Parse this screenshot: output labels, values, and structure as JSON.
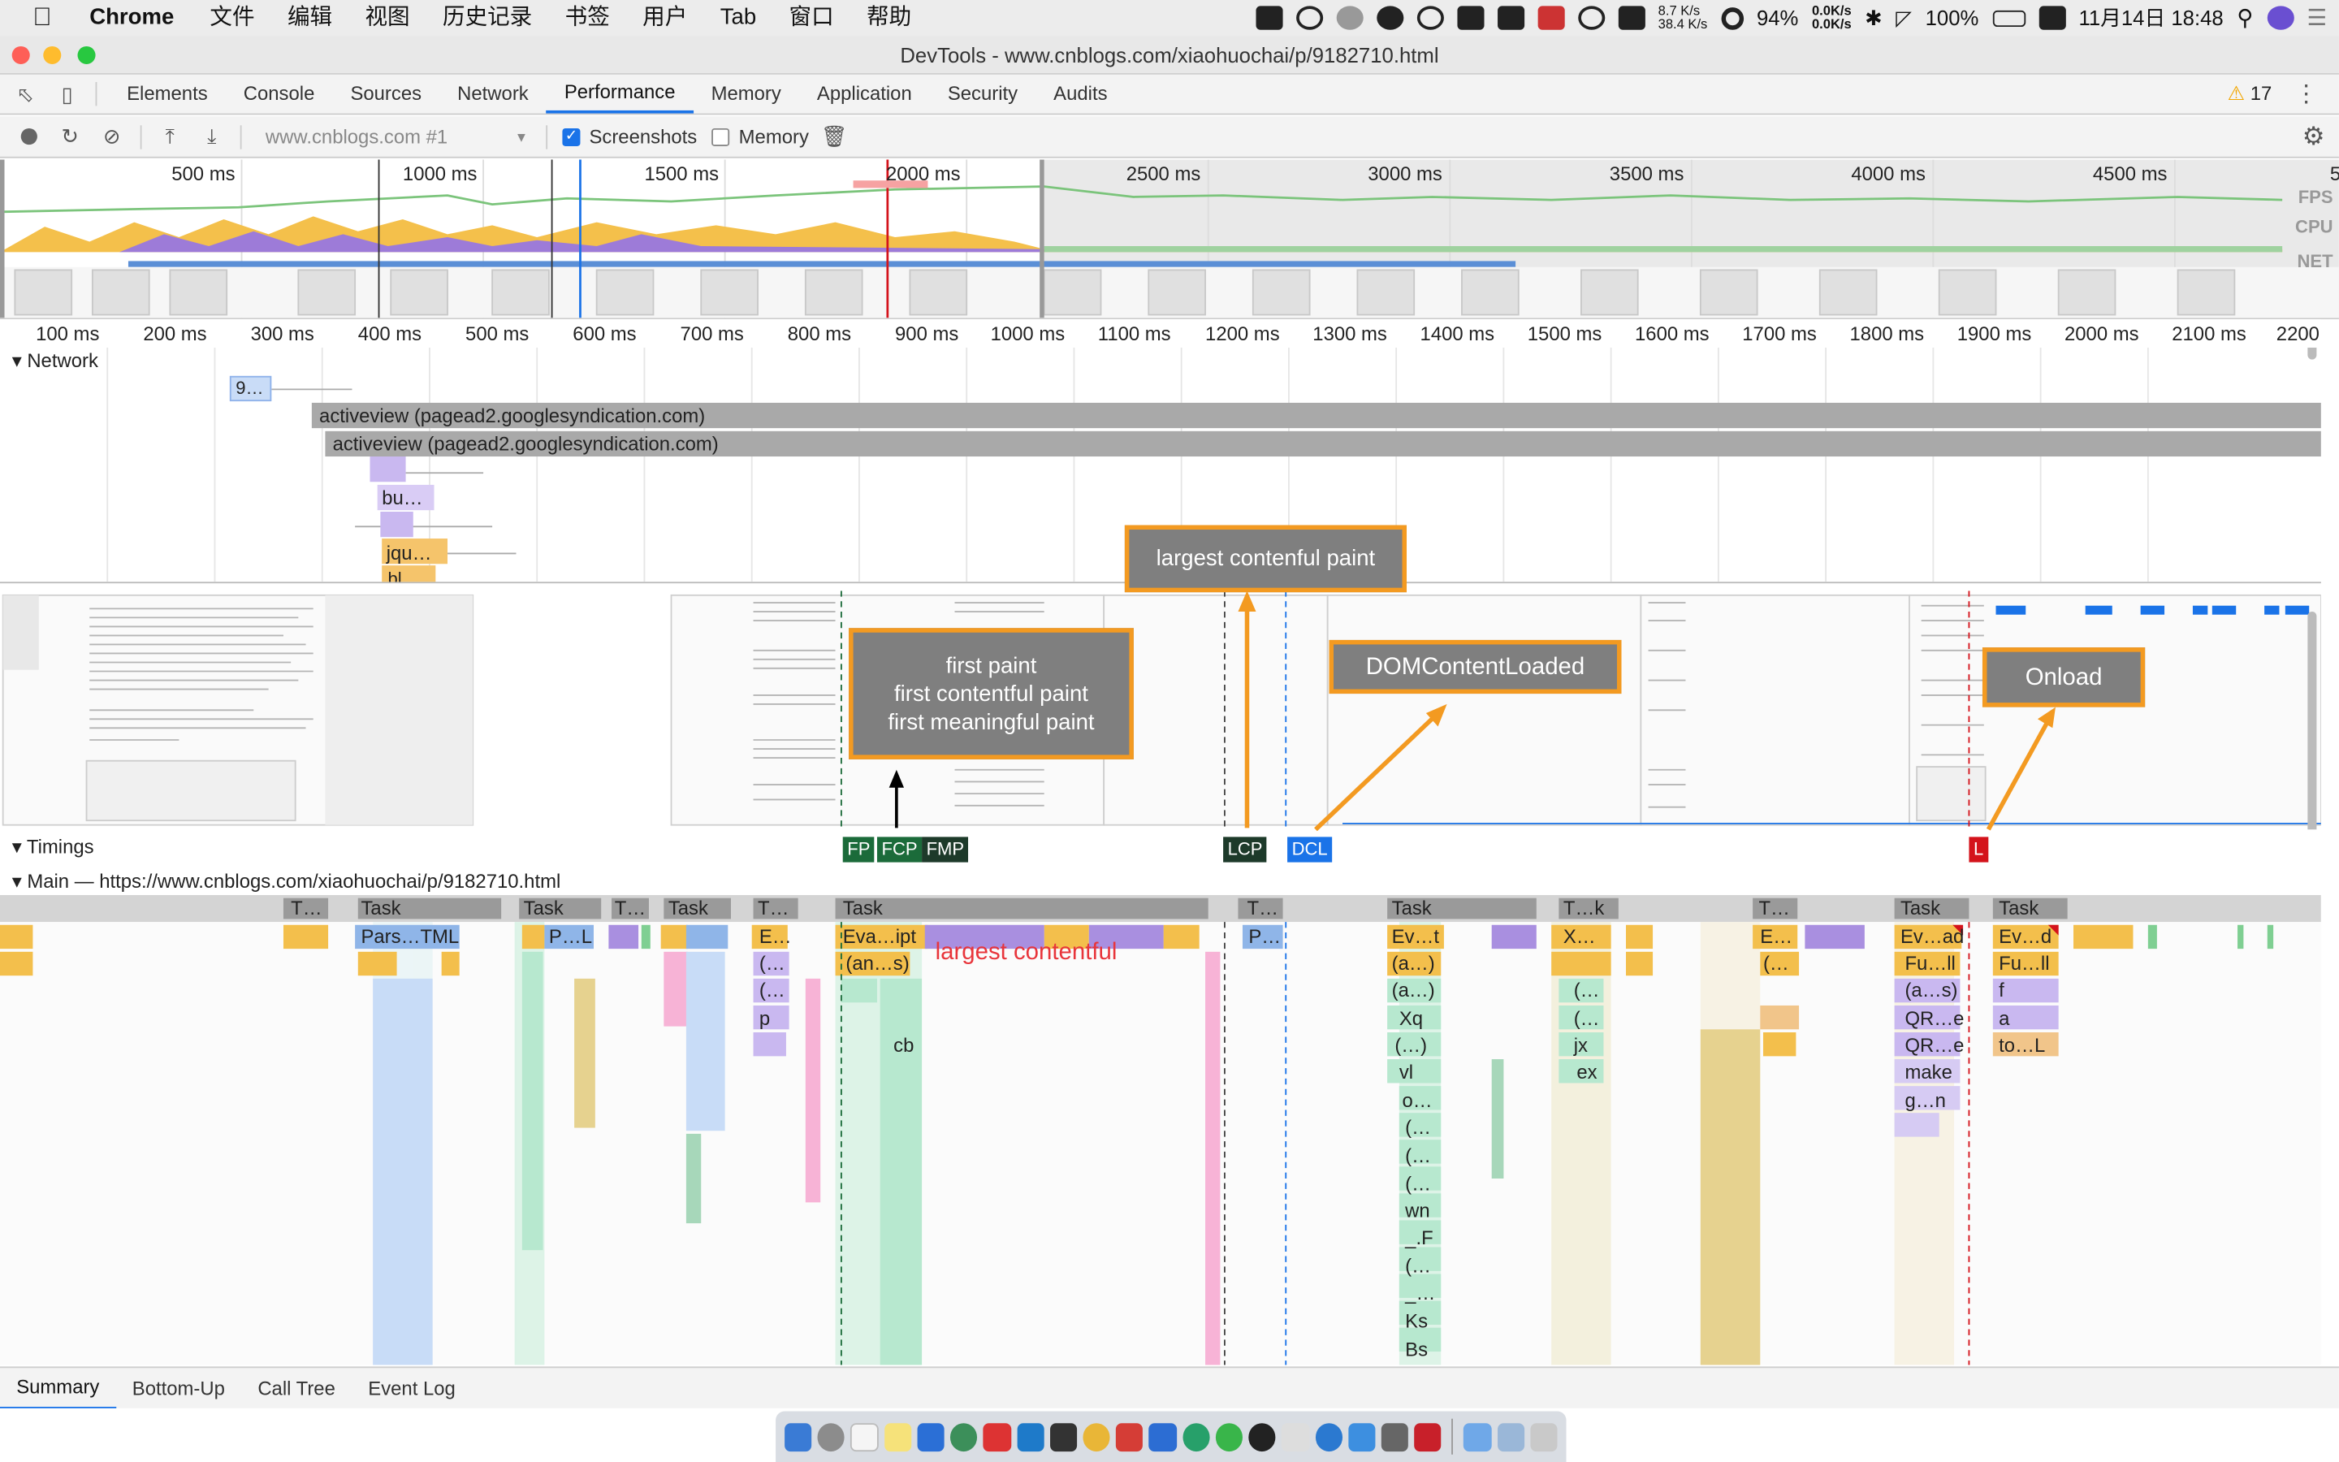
{
  "menubar": {
    "app": "Chrome",
    "items": [
      "文件",
      "编辑",
      "视图",
      "历史记录",
      "书签",
      "用户",
      "Tab",
      "窗口",
      "帮助"
    ],
    "net_up": "8.7 K/s",
    "net_down": "38.4 K/s",
    "cpu": "94%",
    "disk_up": "0.0K/s",
    "disk_down": "0.0K/s",
    "battery": "100%",
    "datetime": "11月14日 18:48"
  },
  "window": {
    "title": "DevTools - www.cnblogs.com/xiaohuochai/p/9182710.html"
  },
  "devtools": {
    "tabs": [
      "Elements",
      "Console",
      "Sources",
      "Network",
      "Performance",
      "Memory",
      "Application",
      "Security",
      "Audits"
    ],
    "active_tab": "Performance",
    "warnings": "17"
  },
  "toolbar": {
    "url_select": "www.cnblogs.com #1",
    "screenshots_label": "Screenshots",
    "screenshots_checked": true,
    "memory_label": "Memory",
    "memory_checked": false
  },
  "overview": {
    "ticks": [
      "500 ms",
      "1000 ms",
      "1500 ms",
      "2000 ms",
      "2500 ms",
      "3000 ms",
      "3500 ms",
      "4000 ms",
      "4500 ms",
      "5"
    ],
    "tracks": [
      "FPS",
      "CPU",
      "NET"
    ]
  },
  "ruler": {
    "ticks": [
      "100 ms",
      "200 ms",
      "300 ms",
      "400 ms",
      "500 ms",
      "600 ms",
      "700 ms",
      "800 ms",
      "900 ms",
      "1000 ms",
      "1100 ms",
      "1200 ms",
      "1300 ms",
      "1400 ms",
      "1500 ms",
      "1600 ms",
      "1700 ms",
      "1800 ms",
      "1900 ms",
      "2000 ms",
      "2100 ms",
      "2200"
    ]
  },
  "network": {
    "label": "Network",
    "requests": [
      "9…",
      "activeview (pagead2.googlesyndication.com)",
      "activeview (pagead2.googlesyndication.com)",
      "bu…",
      "jqu…",
      "bl…"
    ]
  },
  "callouts": {
    "paint": [
      "first paint",
      "first contentful paint",
      "first meaningful paint"
    ],
    "lcp": "largest contenful paint",
    "dcl": "DOMContentLoaded",
    "onload": "Onload",
    "red_text": "largest contentful"
  },
  "timings": {
    "label": "Timings",
    "markers": [
      "FP",
      "FCP",
      "FMP",
      "LCP",
      "DCL",
      "L"
    ]
  },
  "main": {
    "label": "Main — https://www.cnblogs.com/xiaohuochai/p/9182710.html",
    "row1": [
      "T…",
      "Task",
      "Task",
      "T…",
      "Task",
      "T…",
      "Task",
      "T…",
      "Task",
      "T…k",
      "T…",
      "Task",
      "Task"
    ],
    "row2": [
      "Pars…TML",
      "P…L",
      "E…",
      "Eva…ipt",
      "P…",
      "Ev…t",
      "X…",
      "E…",
      "Ev…ad",
      "Ev…d"
    ],
    "row3": [
      "(an…s)",
      "(a…)",
      "(…",
      "(…",
      "Fu…ll",
      "Fu…ll"
    ],
    "row4": [
      "(…",
      "(a…)",
      "(…",
      "(a…s)",
      "f"
    ],
    "row5": [
      "p",
      "Xq",
      "(…",
      "QR…e",
      "a"
    ],
    "row6": [
      "cb",
      "(…)",
      "jx",
      "QR…e",
      "to…L"
    ],
    "col_labels": [
      "vl",
      "ex",
      "make",
      "o…",
      "g…n",
      "(…",
      "(…",
      "(…",
      "wn",
      "_.F",
      "(…",
      "_…",
      "Ks",
      "Bs"
    ]
  },
  "bottom_tabs": [
    "Summary",
    "Bottom-Up",
    "Call Tree",
    "Event Log"
  ],
  "colors": {
    "callout_border": "#f39a21",
    "callout_bg": "#7f7f7f",
    "fp_green": "#1b6b3a",
    "lcp_dark": "#1d3a2a",
    "dcl_blue": "#1a73e8",
    "load_red": "#d4131b"
  }
}
